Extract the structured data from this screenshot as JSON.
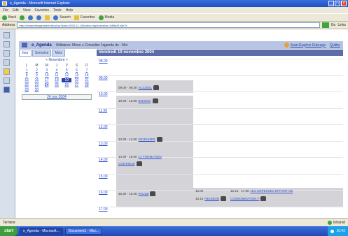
{
  "window": {
    "title": "e_Agenda - Microsoft Internet Explorer"
  },
  "menu": [
    "File",
    "Edit",
    "View",
    "Favorites",
    "Tools",
    "Help"
  ],
  "toolbar": {
    "back": "Back",
    "search": "Search",
    "favorites": "Favorites",
    "media": "Media"
  },
  "address": {
    "label": "Address",
    "value": "http://intranet/eagenda/index.php?date=2004-11-19&view=day&session=3df5a91c0e7b",
    "go": "Go",
    "links": "Links"
  },
  "app": {
    "title": "e_Agenda",
    "nav": "Utilitaires: Menu",
    "nav2": "Consulter l'agenda de : Moi",
    "user": "Jean-Eugène Dubrage",
    "quit": "Quitter"
  },
  "calendar": {
    "tabs": [
      "Jour",
      "Semaine",
      "Mois"
    ],
    "month": "< Novembre >",
    "day_names": [
      "L",
      "M",
      "M",
      "J",
      "V",
      "S",
      "D"
    ],
    "weeks": [
      [
        "1",
        "2",
        "3",
        "4",
        "5",
        "6",
        "7"
      ],
      [
        "8",
        "9",
        "10",
        "11",
        "12",
        "13",
        "14"
      ],
      [
        "15",
        "16",
        "17",
        "18",
        "19",
        "20",
        "21"
      ],
      [
        "22",
        "23",
        "24",
        "25",
        "26",
        "27",
        "28"
      ],
      [
        "29",
        "30",
        "",
        "",
        "",
        "",
        ""
      ]
    ],
    "selected": "19",
    "today_link": "24 nov 2004"
  },
  "day": {
    "title": "Vendredi 19 novembre 2004",
    "hours": [
      "08.00",
      "09.00",
      "10.00",
      "11.00",
      "12.00",
      "13.00",
      "14.00",
      "15.00",
      "16.00",
      "17.00"
    ],
    "events": [
      {
        "time": "09.00 - 09.30",
        "label": "ACCUEIL"
      },
      {
        "time": "10.00 - 12.00",
        "label": "Entretien"
      },
      {
        "time": "13.30 - 14.00",
        "label": "DEJEUNER"
      },
      {
        "time": "14.30 - 15.00",
        "label": "LA FORMATION"
      },
      {
        "label": "CONTINUE"
      },
      {
        "time": "16.30 - 16.45",
        "label": "PAUSE"
      },
      {
        "time": "16.00",
        "label": ""
      },
      {
        "time": "16.15",
        "label": "REUNION"
      },
      {
        "time": "16.15 - 17.00",
        "label": "LES DEPENSES EFFORT DE"
      },
      {
        "label": "CONSOMMATION F"
      }
    ]
  },
  "status": {
    "left": "Terminé",
    "right": "Intranet"
  },
  "taskbar": {
    "start": "start",
    "items": [
      "e_Agenda - Microsoft...",
      "Document1 - Micr..."
    ],
    "clock": "10:42"
  }
}
